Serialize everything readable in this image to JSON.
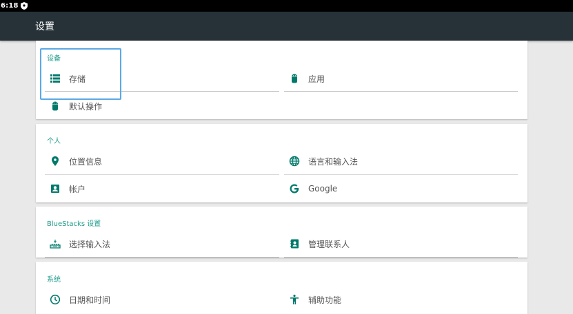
{
  "status_bar": {
    "time": "6:18"
  },
  "app_bar": {
    "title": "设置"
  },
  "sections": {
    "device": {
      "title": "设备",
      "storage": "存储",
      "apps": "应用",
      "default_actions": "默认操作"
    },
    "personal": {
      "title": "个人",
      "location": "位置信息",
      "language_input": "语言和输入法",
      "accounts": "帐户",
      "google": "Google"
    },
    "bluestacks": {
      "title": "BlueStacks 设置",
      "choose_input": "选择输入法",
      "manage_contacts": "管理联系人"
    },
    "system": {
      "title": "系统",
      "date_time": "日期和时间",
      "accessibility": "辅助功能"
    }
  },
  "colors": {
    "accent": "#1e9b8c",
    "icon": "#00796b",
    "app_bar": "#263238",
    "focus": "#5aa9e6"
  }
}
